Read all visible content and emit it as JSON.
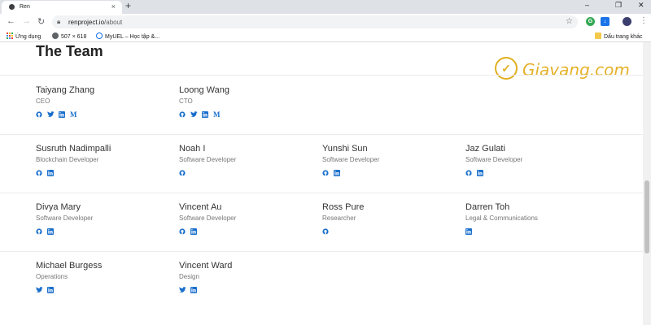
{
  "browser": {
    "tab_title": "Ren",
    "url_host": "renproject.io",
    "url_path": "/about",
    "bookmarks": [
      "Ứng dụng",
      "507 × 618",
      "MyUEL – Học tập &...",
      "Dấu trang khác"
    ]
  },
  "page": {
    "heading": "The Team",
    "watermark": "Giavang.com",
    "rows": [
      [
        {
          "name": "Taiyang Zhang",
          "role": "CEO",
          "socials": [
            "github-icon",
            "twitter-icon",
            "linkedin-icon",
            "medium-icon"
          ]
        },
        {
          "name": "Loong Wang",
          "role": "CTO",
          "socials": [
            "github-icon",
            "twitter-icon",
            "linkedin-icon",
            "medium-icon"
          ]
        }
      ],
      [
        {
          "name": "Susruth Nadimpalli",
          "role": "Blockchain Developer",
          "socials": [
            "github-icon",
            "linkedin-icon"
          ]
        },
        {
          "name": "Noah I",
          "role": "Software Developer",
          "socials": [
            "github-icon"
          ]
        },
        {
          "name": "Yunshi Sun",
          "role": "Software Developer",
          "socials": [
            "github-icon",
            "linkedin-icon"
          ]
        },
        {
          "name": "Jaz Gulati",
          "role": "Software Developer",
          "socials": [
            "github-icon",
            "linkedin-icon"
          ]
        }
      ],
      [
        {
          "name": "Divya Mary",
          "role": "Software Developer",
          "socials": [
            "github-icon",
            "linkedin-icon"
          ]
        },
        {
          "name": "Vincent Au",
          "role": "Software Developer",
          "socials": [
            "github-icon",
            "linkedin-icon"
          ]
        },
        {
          "name": "Ross Pure",
          "role": "Researcher",
          "socials": [
            "github-icon"
          ]
        },
        {
          "name": "Darren Toh",
          "role": "Legal & Communications",
          "socials": [
            "linkedin-icon"
          ]
        }
      ],
      [
        {
          "name": "Michael Burgess",
          "role": "Operations",
          "socials": [
            "twitter-icon",
            "linkedin-icon"
          ]
        },
        {
          "name": "Vincent Ward",
          "role": "Design",
          "socials": [
            "twitter-icon",
            "linkedin-icon"
          ]
        }
      ]
    ]
  },
  "colors": {
    "link": "#1a6fcc",
    "watermark": "#e6b22a"
  }
}
